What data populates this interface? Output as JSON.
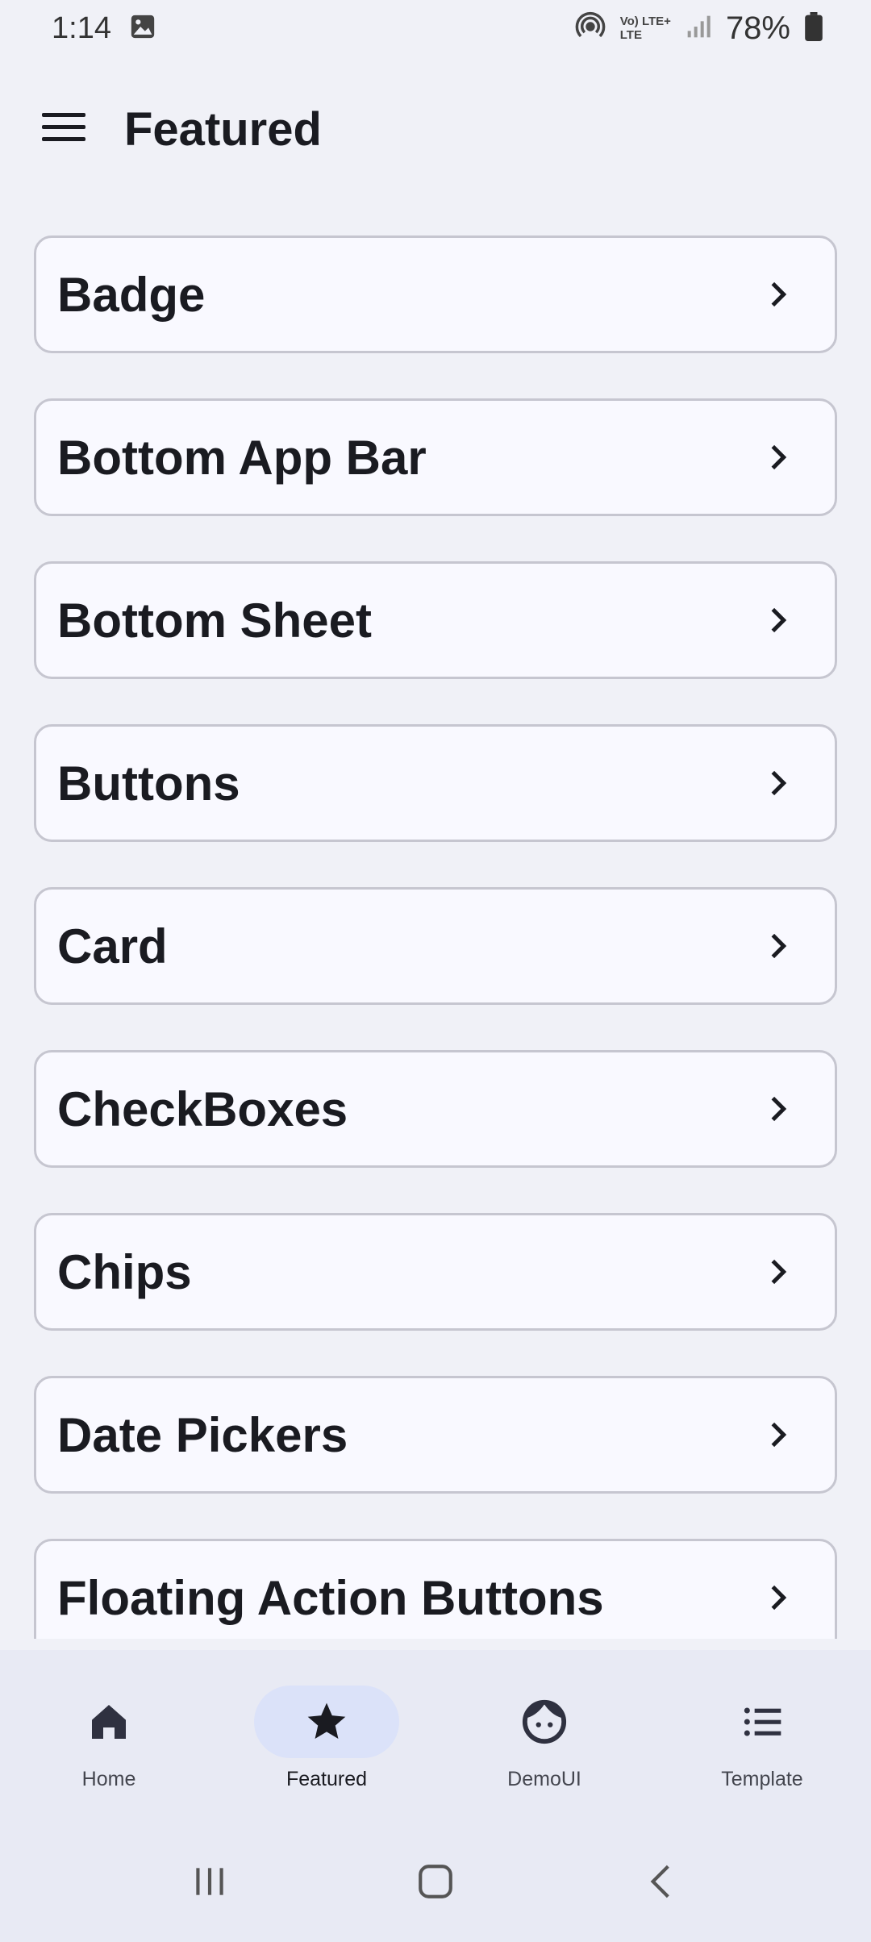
{
  "status_bar": {
    "time": "1:14",
    "net_top": "Vo) LTE+",
    "net_bottom": "LTE",
    "battery": "78%"
  },
  "app_bar": {
    "title": "Featured",
    "menu_icon": "hamburger-menu-icon"
  },
  "items": [
    {
      "label": "Badge"
    },
    {
      "label": "Bottom App Bar"
    },
    {
      "label": "Bottom Sheet"
    },
    {
      "label": "Buttons"
    },
    {
      "label": "Card"
    },
    {
      "label": "CheckBoxes"
    },
    {
      "label": "Chips"
    },
    {
      "label": "Date Pickers"
    },
    {
      "label": "Floating Action Buttons"
    }
  ],
  "bottom_nav": [
    {
      "label": "Home",
      "icon": "home-icon",
      "active": false
    },
    {
      "label": "Featured",
      "icon": "star-icon",
      "active": true
    },
    {
      "label": "DemoUI",
      "icon": "face-icon",
      "active": false
    },
    {
      "label": "Template",
      "icon": "list-icon",
      "active": false
    }
  ],
  "colors": {
    "background": "#f0f1f7",
    "card": "#f9f9ff",
    "card_border": "#c6c6d0",
    "nav_bg": "#e8eaf4",
    "nav_active_pill": "#dbe2f9"
  }
}
